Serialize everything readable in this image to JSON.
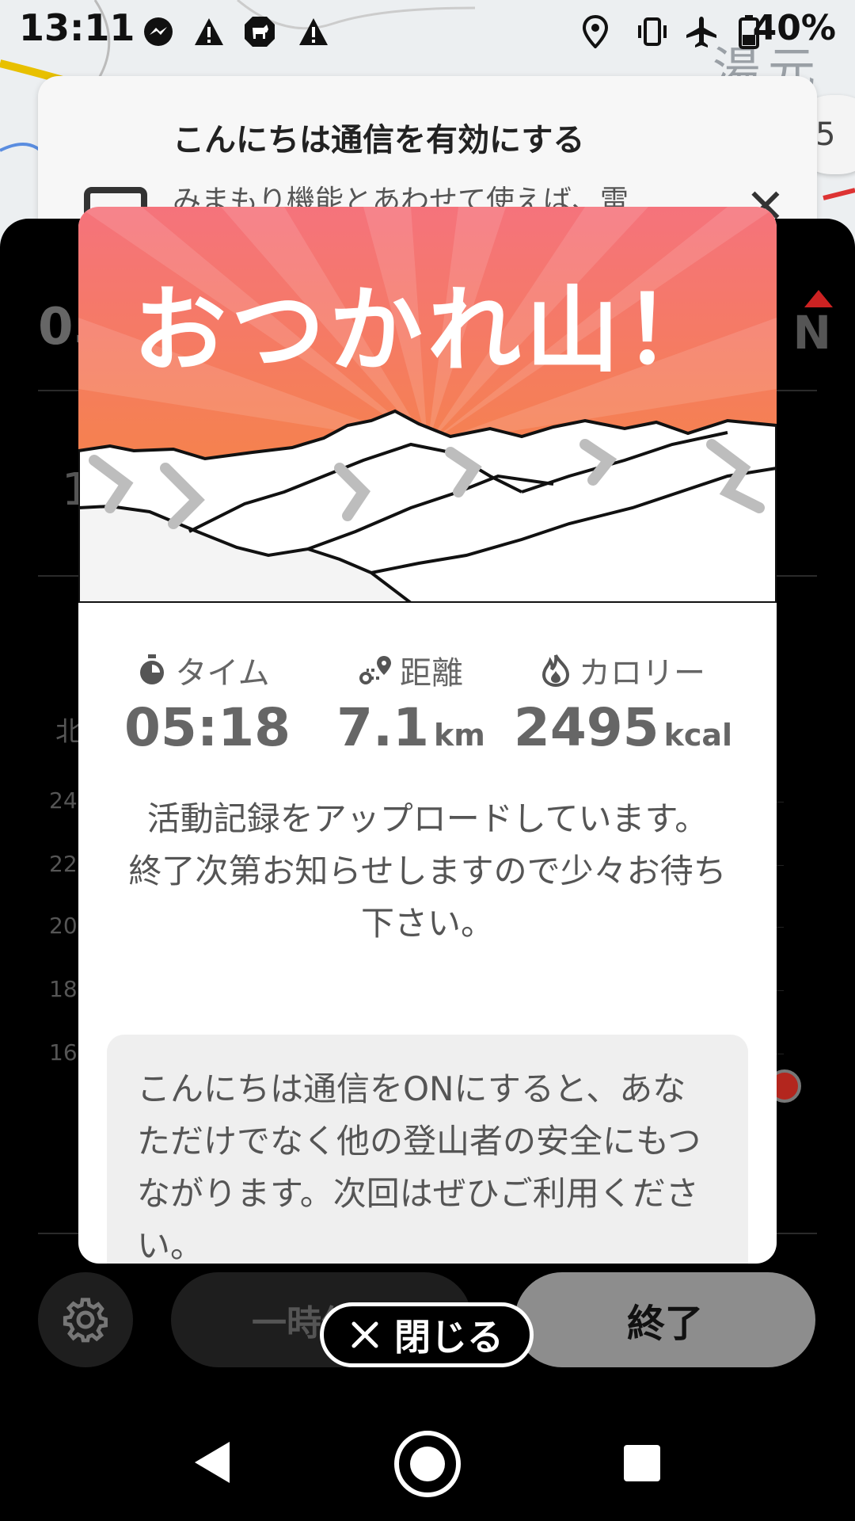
{
  "status_bar": {
    "time": "13:11",
    "battery": "40%",
    "icons": [
      "messenger-icon",
      "alert-icon",
      "dog-icon",
      "alert-icon",
      "location-icon",
      "vibrate-icon",
      "airplane-icon",
      "battery-icon"
    ]
  },
  "map": {
    "place_label": "湯元",
    "zoom_partial": "5"
  },
  "banner": {
    "title": "こんにちは通信を有効にする",
    "body": "みまもり機能とあわせて使えば、雷"
  },
  "dashboard": {
    "time_partial": "05",
    "north_partial": "N",
    "row_partial": "1",
    "direction_partial": "北",
    "y_ticks": [
      "24",
      "22",
      "20",
      "18",
      "16"
    ],
    "pause_label": "一時停止",
    "end_label": "終了"
  },
  "modal": {
    "title": "おつかれ山！",
    "stats": {
      "time": {
        "label": "タイム",
        "value": "05:18",
        "unit": ""
      },
      "distance": {
        "label": "距離",
        "value": "7.1",
        "unit": "km"
      },
      "calories": {
        "label": "カロリー",
        "value": "2495",
        "unit": "kcal"
      }
    },
    "message_line1": "活動記録をアップロードしています。",
    "message_line2": "終了次第お知らせしますので少々お待ち下さい。",
    "info_text": "こんにちは通信をONにすると、あなただけでなく他の登山者の安全にもつながります。次回はぜひご利用ください。"
  },
  "close_button": {
    "label": "閉じる"
  },
  "colors": {
    "hero_top": "#f5707a",
    "hero_bottom": "#f58238",
    "end_button": "#8d8d8d"
  }
}
